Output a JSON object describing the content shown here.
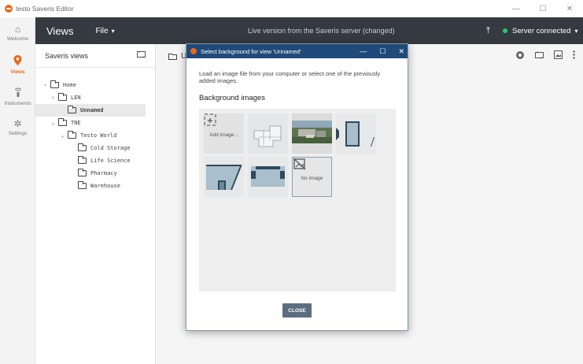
{
  "window": {
    "title": "testo Saveris Editor",
    "controls": [
      "—",
      "☐",
      "✕"
    ]
  },
  "rail": {
    "items": [
      {
        "label": "Welcome",
        "icon": "home-icon",
        "glyph": "⌂"
      },
      {
        "label": "Views",
        "icon": "location-pin-icon",
        "glyph": "⬤",
        "active": true
      },
      {
        "label": "Instruments",
        "icon": "instrument-icon",
        "glyph": "⦾"
      },
      {
        "label": "Settings",
        "icon": "gear-icon",
        "glyph": "✲"
      }
    ]
  },
  "header": {
    "views_label": "Views",
    "file_label": "File",
    "file_caret": "▾",
    "center_text": "Live version from the Saveris server (changed)",
    "upload_glyph": "⤒",
    "status_text": "Server connected",
    "status_caret": "▾",
    "status_color": "#28c76f"
  },
  "views_panel": {
    "title": "Saveris views",
    "tree": [
      {
        "label": "Home",
        "chev": "›",
        "level": 0
      },
      {
        "label": "LEN",
        "chev": "›",
        "level": 1
      },
      {
        "label": "Unnamed",
        "chev": "",
        "level": 2,
        "selected": true
      },
      {
        "label": "TNE",
        "chev": "⌄",
        "level": 1
      },
      {
        "label": "Testo World",
        "chev": "⌄",
        "level": 2
      },
      {
        "label": "Cold Storage",
        "chev": "",
        "level": 3
      },
      {
        "label": "Life Science",
        "chev": "",
        "level": 3
      },
      {
        "label": "Pharmacy",
        "chev": "",
        "level": 3
      },
      {
        "label": "Warehouse",
        "chev": "",
        "level": 3
      }
    ]
  },
  "main": {
    "folder_label": "Un"
  },
  "dialog": {
    "title": "Select background for view 'Unnamed'",
    "description": "Load an image file from your computer or select one of the previously added images.",
    "section_title": "Background images",
    "add_label": "Add image...",
    "no_image_label": "No image",
    "close_label": "CLOSE",
    "accent": "#1f4a7a"
  }
}
